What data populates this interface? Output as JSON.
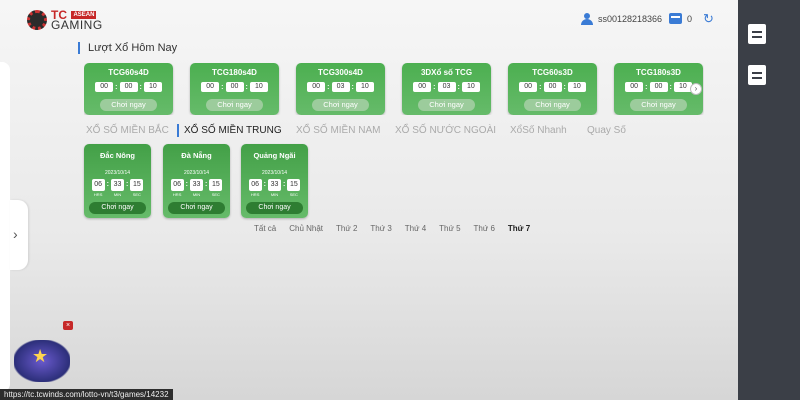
{
  "header": {
    "logo_tc": "TC",
    "logo_asean": "ASEAN",
    "logo_gaming": "GAMING",
    "username": "ss00128218366",
    "balance": "0"
  },
  "today": {
    "title": "Lượt Xổ Hôm Nay",
    "play_label": "Chơi ngay",
    "cards": [
      {
        "name": "TCG60s4D",
        "t": [
          "00",
          "00",
          "10"
        ]
      },
      {
        "name": "TCG180s4D",
        "t": [
          "00",
          "00",
          "10"
        ]
      },
      {
        "name": "TCG300s4D",
        "t": [
          "00",
          "03",
          "10"
        ]
      },
      {
        "name": "3DXổ số TCG",
        "t": [
          "00",
          "03",
          "10"
        ]
      },
      {
        "name": "TCG60s3D",
        "t": [
          "00",
          "00",
          "10"
        ]
      },
      {
        "name": "TCG180s3D",
        "t": [
          "00",
          "00",
          "10"
        ]
      }
    ],
    "next_icon": "›"
  },
  "tabs": [
    {
      "label": "XỔ SỐ MIỀN BẮC",
      "active": false
    },
    {
      "label": "XỔ SỐ MIỀN TRUNG",
      "active": true
    },
    {
      "label": "XỔ SỐ MIỀN NAM",
      "active": false
    },
    {
      "label": "XỔ SỐ NƯỚC NGOÀI",
      "active": false
    },
    {
      "label": "XổSố Nhanh",
      "active": false
    },
    {
      "label": "Quay Số",
      "active": false
    }
  ],
  "provinces": {
    "play_label": "Chơi ngay",
    "hrs": "HRS",
    "min": "MIN",
    "sec": "SEC",
    "cards": [
      {
        "name": "Đắc Nông",
        "date": "2023/10/14",
        "h": "06",
        "m": "33",
        "s": "15"
      },
      {
        "name": "Đà Nẵng",
        "date": "2023/10/14",
        "h": "06",
        "m": "33",
        "s": "15"
      },
      {
        "name": "Quảng Ngãi",
        "date": "2023/10/14",
        "h": "06",
        "m": "33",
        "s": "15"
      }
    ]
  },
  "days": {
    "items": [
      "Tất cả",
      "Chủ Nhật",
      "Thứ 2",
      "Thứ 3",
      "Thứ 4",
      "Thứ 5",
      "Thứ 6",
      "Thứ 7"
    ],
    "active": "Thứ 7"
  },
  "status_url": "https://tc.tcwinds.com/lotto-vn/t3/games/14232",
  "left": {
    "arrow": "›",
    "close": "×"
  },
  "colors": {
    "accent": "#3a7bd5",
    "card_green": "#4caf50",
    "brand_red": "#c62828"
  }
}
